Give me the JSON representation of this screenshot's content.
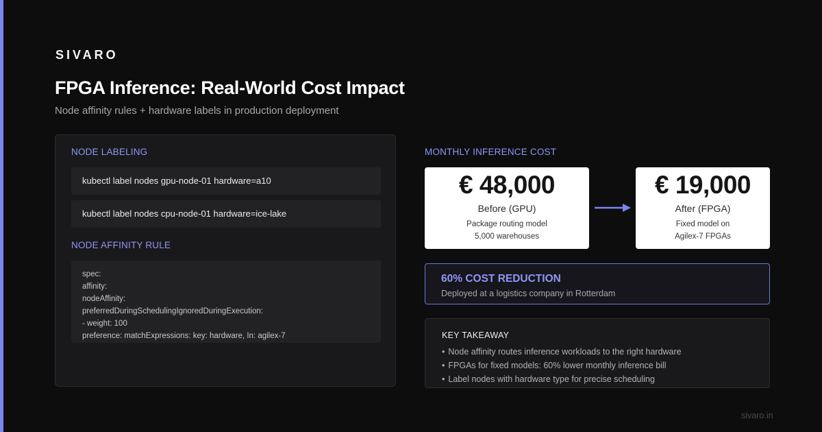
{
  "brand": "SIVARO",
  "title": "FPGA Inference: Real-World Cost Impact",
  "subtitle": "Node affinity rules + hardware labels in production deployment",
  "node_labeling": {
    "label": "NODE LABELING",
    "commands": [
      "kubectl label nodes gpu-node-01 hardware=a10",
      "kubectl label nodes cpu-node-01 hardware=ice-lake"
    ]
  },
  "node_affinity": {
    "label": "NODE AFFINITY RULE",
    "code_lines": [
      "spec:",
      "affinity:",
      "nodeAffinity:",
      "preferredDuringSchedulingIgnoredDuringExecution:",
      "- weight: 100",
      "preference: matchExpressions: key: hardware, In: agilex-7"
    ]
  },
  "cost": {
    "label": "MONTHLY INFERENCE COST",
    "before": {
      "amount": "€ 48,000",
      "caption": "Before (GPU)",
      "detail_1": "Package routing model",
      "detail_2": "5,000 warehouses"
    },
    "after": {
      "amount": "€ 19,000",
      "caption": "After (FPGA)",
      "detail_1": "Fixed model on",
      "detail_2": "Agilex-7 FPGAs"
    },
    "arrow_icon": "arrow-right-icon"
  },
  "reduction": {
    "title": "60% COST REDUCTION",
    "subtitle": "Deployed at a logistics company in Rotterdam"
  },
  "takeaway": {
    "title": "KEY TAKEAWAY",
    "items": [
      "Node affinity routes inference workloads to the right hardware",
      "FPGAs for fixed models: 60% lower monthly inference bill",
      "Label nodes with hardware type for precise scheduling"
    ]
  },
  "footer": "sivaro.in",
  "colors": {
    "accent": "#8e97f5",
    "accent_bar": "#7b85f0",
    "background": "#0d0d0e",
    "panel": "#19191b",
    "card": "#ffffff"
  }
}
